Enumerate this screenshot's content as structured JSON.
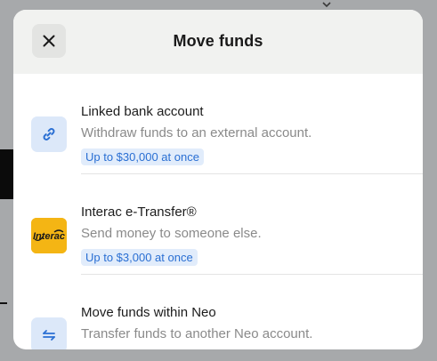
{
  "modal": {
    "title": "Move funds",
    "close_icon": "close-icon"
  },
  "options": [
    {
      "title": "Linked bank account",
      "subtitle": "Withdraw funds to an external account.",
      "badge": "Up to $30,000 at once",
      "icon": "link-icon"
    },
    {
      "title": "Interac e-Transfer®",
      "subtitle": "Send money to someone else.",
      "badge": "Up to $3,000 at once",
      "icon": "interac-logo",
      "logo_text": "Interac"
    },
    {
      "title": "Move funds within Neo",
      "subtitle": "Transfer funds to another Neo account.",
      "icon": "transfer-arrows-icon"
    }
  ],
  "colors": {
    "accent": "#2a6fd3",
    "badge_bg": "#e1ecfb",
    "icon_bg": "#dce8f9",
    "interac_yellow": "#f4b514",
    "header_bg": "#f1f2f0",
    "backdrop": "#a7a9ab"
  }
}
